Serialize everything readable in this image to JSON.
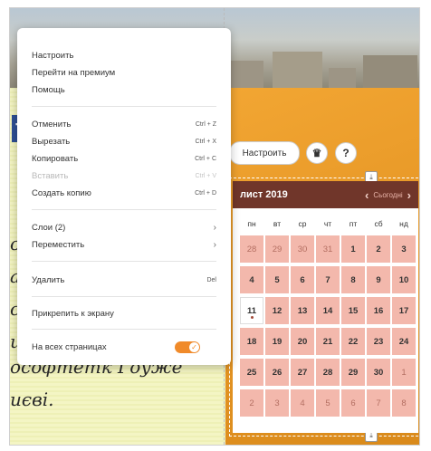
{
  "background": {
    "text_lines": [
      "о",
      "ат",
      "сц",
      "ш",
      "ософтетк Гоужё",
      "иєві."
    ],
    "facebook_letter": "f"
  },
  "context_menu": {
    "items_top": [
      {
        "label": "Настроить"
      },
      {
        "label": "Перейти на премиум"
      },
      {
        "label": "Помощь"
      }
    ],
    "items_edit": [
      {
        "label": "Отменить",
        "shortcut": "Ctrl + Z",
        "disabled": false
      },
      {
        "label": "Вырезать",
        "shortcut": "Ctrl + X",
        "disabled": false
      },
      {
        "label": "Копировать",
        "shortcut": "Ctrl + C",
        "disabled": false
      },
      {
        "label": "Вставить",
        "shortcut": "Ctrl + V",
        "disabled": true
      },
      {
        "label": "Создать копию",
        "shortcut": "Ctrl + D",
        "disabled": false
      }
    ],
    "items_layers": [
      {
        "label": "Слои (2)",
        "chevron": "›"
      },
      {
        "label": "Переместить",
        "chevron": "›"
      }
    ],
    "delete": {
      "label": "Удалить",
      "shortcut": "Del"
    },
    "pin": {
      "label": "Прикрепить к экрану"
    },
    "all_pages": {
      "label": "На всех страницах",
      "toggle_on": true,
      "check": "✓"
    }
  },
  "toolbar": {
    "settings_label": "Настроить",
    "crown_icon": "♛",
    "help_icon": "?"
  },
  "handles": {
    "download": "⤓"
  },
  "calendar": {
    "title": "лист 2019",
    "today_label": "Сьогодні",
    "prev": "‹",
    "next": "›",
    "header_color": "#70362a",
    "cell_color": "#f3b8ac",
    "weekdays": [
      "пн",
      "вт",
      "ср",
      "чт",
      "пт",
      "сб",
      "нд"
    ],
    "weeks": [
      [
        {
          "d": "28",
          "m": true
        },
        {
          "d": "29",
          "m": true
        },
        {
          "d": "30",
          "m": true
        },
        {
          "d": "31",
          "m": true
        },
        {
          "d": "1",
          "m": false
        },
        {
          "d": "2",
          "m": false
        },
        {
          "d": "3",
          "m": false
        }
      ],
      [
        {
          "d": "4",
          "m": false
        },
        {
          "d": "5",
          "m": false
        },
        {
          "d": "6",
          "m": false
        },
        {
          "d": "7",
          "m": false
        },
        {
          "d": "8",
          "m": false
        },
        {
          "d": "9",
          "m": false
        },
        {
          "d": "10",
          "m": false
        }
      ],
      [
        {
          "d": "11",
          "m": false,
          "today": true
        },
        {
          "d": "12",
          "m": false
        },
        {
          "d": "13",
          "m": false
        },
        {
          "d": "14",
          "m": false
        },
        {
          "d": "15",
          "m": false
        },
        {
          "d": "16",
          "m": false
        },
        {
          "d": "17",
          "m": false
        }
      ],
      [
        {
          "d": "18",
          "m": false
        },
        {
          "d": "19",
          "m": false
        },
        {
          "d": "20",
          "m": false
        },
        {
          "d": "21",
          "m": false
        },
        {
          "d": "22",
          "m": false
        },
        {
          "d": "23",
          "m": false
        },
        {
          "d": "24",
          "m": false
        }
      ],
      [
        {
          "d": "25",
          "m": false
        },
        {
          "d": "26",
          "m": false
        },
        {
          "d": "27",
          "m": false
        },
        {
          "d": "28",
          "m": false
        },
        {
          "d": "29",
          "m": false
        },
        {
          "d": "30",
          "m": false
        },
        {
          "d": "1",
          "m": true
        }
      ],
      [
        {
          "d": "2",
          "m": true
        },
        {
          "d": "3",
          "m": true
        },
        {
          "d": "4",
          "m": true
        },
        {
          "d": "5",
          "m": true
        },
        {
          "d": "6",
          "m": true
        },
        {
          "d": "7",
          "m": true
        },
        {
          "d": "8",
          "m": true
        }
      ]
    ]
  }
}
